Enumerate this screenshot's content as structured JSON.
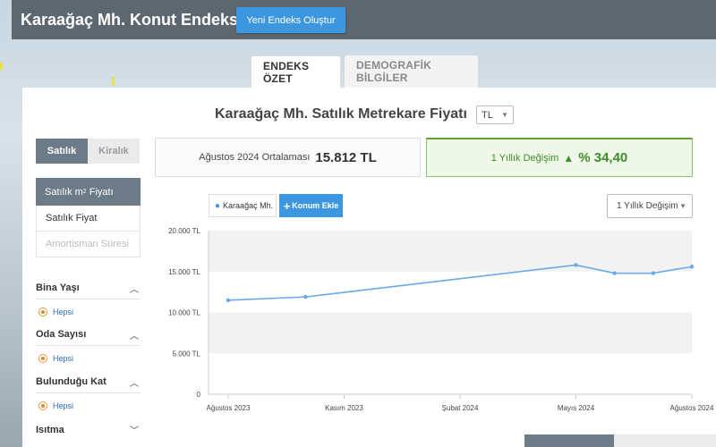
{
  "header": {
    "title": "Karaağaç Mh. Konut Endeksi",
    "new_button": "Yeni Endeks Oluştur"
  },
  "tabs": [
    {
      "label": "ENDEKS ÖZET",
      "active": true
    },
    {
      "label": "DEMOGRAFİK BİLGİLER",
      "active": false
    }
  ],
  "main": {
    "heading": "Karaağaç Mh. Satılık Metrekare Fiyatı",
    "currency": "TL"
  },
  "sidebar": {
    "segment": [
      {
        "label": "Satılık",
        "active": true
      },
      {
        "label": "Kiralık",
        "active": false
      }
    ],
    "menu": [
      {
        "label": "Satılık m",
        "sup": "2",
        "label_suffix": " Fiyatı",
        "selected": true
      },
      {
        "label": "Satılık Fiyat",
        "selected": false
      },
      {
        "label": "Amortisman Süresi",
        "disabled": true
      }
    ],
    "filters": [
      {
        "title": "Bina Yaşı",
        "option": "Hepsi"
      },
      {
        "title": "Oda Sayısı",
        "option": "Hepsi"
      },
      {
        "title": "Bulunduğu Kat",
        "option": "Hepsi"
      },
      {
        "title": "Isıtma",
        "option": ""
      }
    ]
  },
  "stats": {
    "average_label": "Ağustos 2024 Ortalaması",
    "average_value": "15.812 TL",
    "change_label": "1 Yıllık Değişim",
    "change_arrow": "▲",
    "change_value": "% 34,40"
  },
  "chart_controls": {
    "location_chip": "Karaağaç Mh.",
    "add_location": "Konum Ekle",
    "period_select": "1 Yıllık Değişim"
  },
  "colors": {
    "accent": "#3d97e0",
    "line": "#6aa9e8",
    "positive": "#3d8d2a"
  },
  "chart_data": {
    "type": "line",
    "x_ticks": [
      "Ağustos 2023",
      "Kasım 2023",
      "Şubat 2024",
      "Mayıs 2024",
      "Ağustos 2024"
    ],
    "y_ticks": [
      "0",
      "5.000 TL",
      "10.000 TL",
      "15.000 TL",
      "20.000 TL"
    ],
    "ylim": [
      0,
      20000
    ],
    "xlim": [
      0,
      12
    ],
    "series": [
      {
        "name": "Karaağaç Mh.",
        "x": [
          0,
          2,
          9,
          10,
          11,
          12
        ],
        "values": [
          11500,
          11900,
          15800,
          14800,
          14800,
          15600
        ]
      }
    ],
    "grid": "alternating horizontal bands"
  }
}
